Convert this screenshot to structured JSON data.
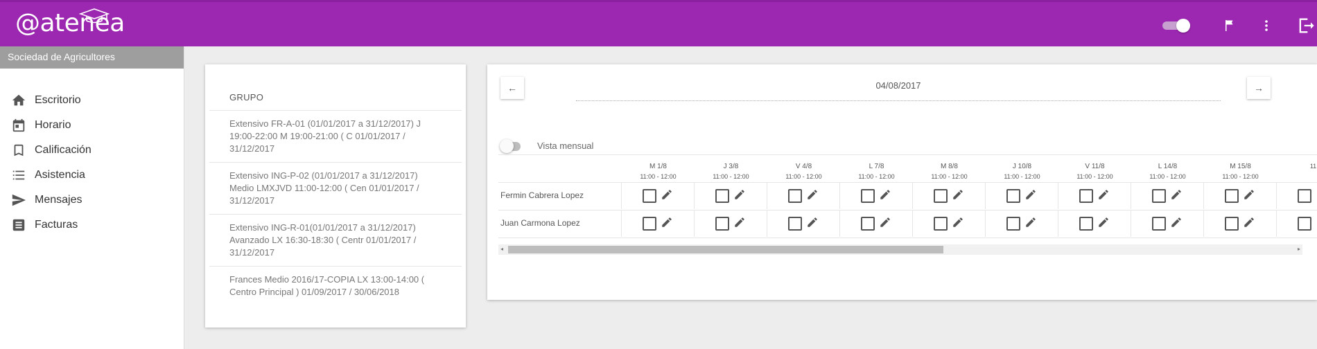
{
  "header": {
    "logo_text": "@atenea",
    "icons": [
      "toggle-switch",
      "flag-icon",
      "more-vert-icon",
      "logout-icon"
    ]
  },
  "sidebar": {
    "organization": "Sociedad de Agricultores",
    "items": [
      {
        "label": "Escritorio",
        "icon": "home-icon"
      },
      {
        "label": "Horario",
        "icon": "calendar-icon"
      },
      {
        "label": "Calificación",
        "icon": "bookmark-icon"
      },
      {
        "label": "Asistencia",
        "icon": "list-icon"
      },
      {
        "label": "Mensajes",
        "icon": "send-icon"
      },
      {
        "label": "Facturas",
        "icon": "receipt-icon"
      }
    ]
  },
  "groups": {
    "header": "GRUPO",
    "items": [
      {
        "label": "Extensivo FR-A-01 (01/01/2017 a 31/12/2017) J 19:00-22:00 M 19:00-21:00 ( C 01/01/2017 / 31/12/2017"
      },
      {
        "label": "Extensivo ING-P-02 (01/01/2017 a 31/12/2017) Medio LMXJVD 11:00-12:00 ( Cen 01/01/2017 / 31/12/2017"
      },
      {
        "label": "Extensivo ING-R-01(01/01/2017 a 31/12/2017) Avanzado LX 16:30-18:30 ( Centr 01/01/2017 / 31/12/2017"
      },
      {
        "label": "Frances Medio 2016/17-COPIA LX 13:00-14:00 ( Centro Principal ) 01/09/2017 / 30/06/2018"
      }
    ]
  },
  "schedule": {
    "date": "04/08/2017",
    "prev_label": "←",
    "next_label": "→",
    "monthly_view_label": "Vista mensual",
    "monthly_view_on": false,
    "columns": [
      {
        "day": "M 1/8",
        "time": "11:00 - 12:00"
      },
      {
        "day": "J 3/8",
        "time": "11:00 - 12:00"
      },
      {
        "day": "V 4/8",
        "time": "11:00 - 12:00"
      },
      {
        "day": "L 7/8",
        "time": "11:00 - 12:00"
      },
      {
        "day": "M 8/8",
        "time": "11:00 - 12:00"
      },
      {
        "day": "J 10/8",
        "time": "11:00 - 12:00"
      },
      {
        "day": "V 11/8",
        "time": "11:00 - 12:00"
      },
      {
        "day": "L 14/8",
        "time": "11:00 - 12:00"
      },
      {
        "day": "M 15/8",
        "time": "11:00 - 12:00"
      },
      {
        "day": "",
        "time": "11"
      }
    ],
    "students": [
      {
        "name": "Fermin Cabrera Lopez"
      },
      {
        "name": "Juan Carmona Lopez"
      }
    ],
    "scroll_arrows": {
      "left": "◂",
      "right": "▸"
    }
  }
}
